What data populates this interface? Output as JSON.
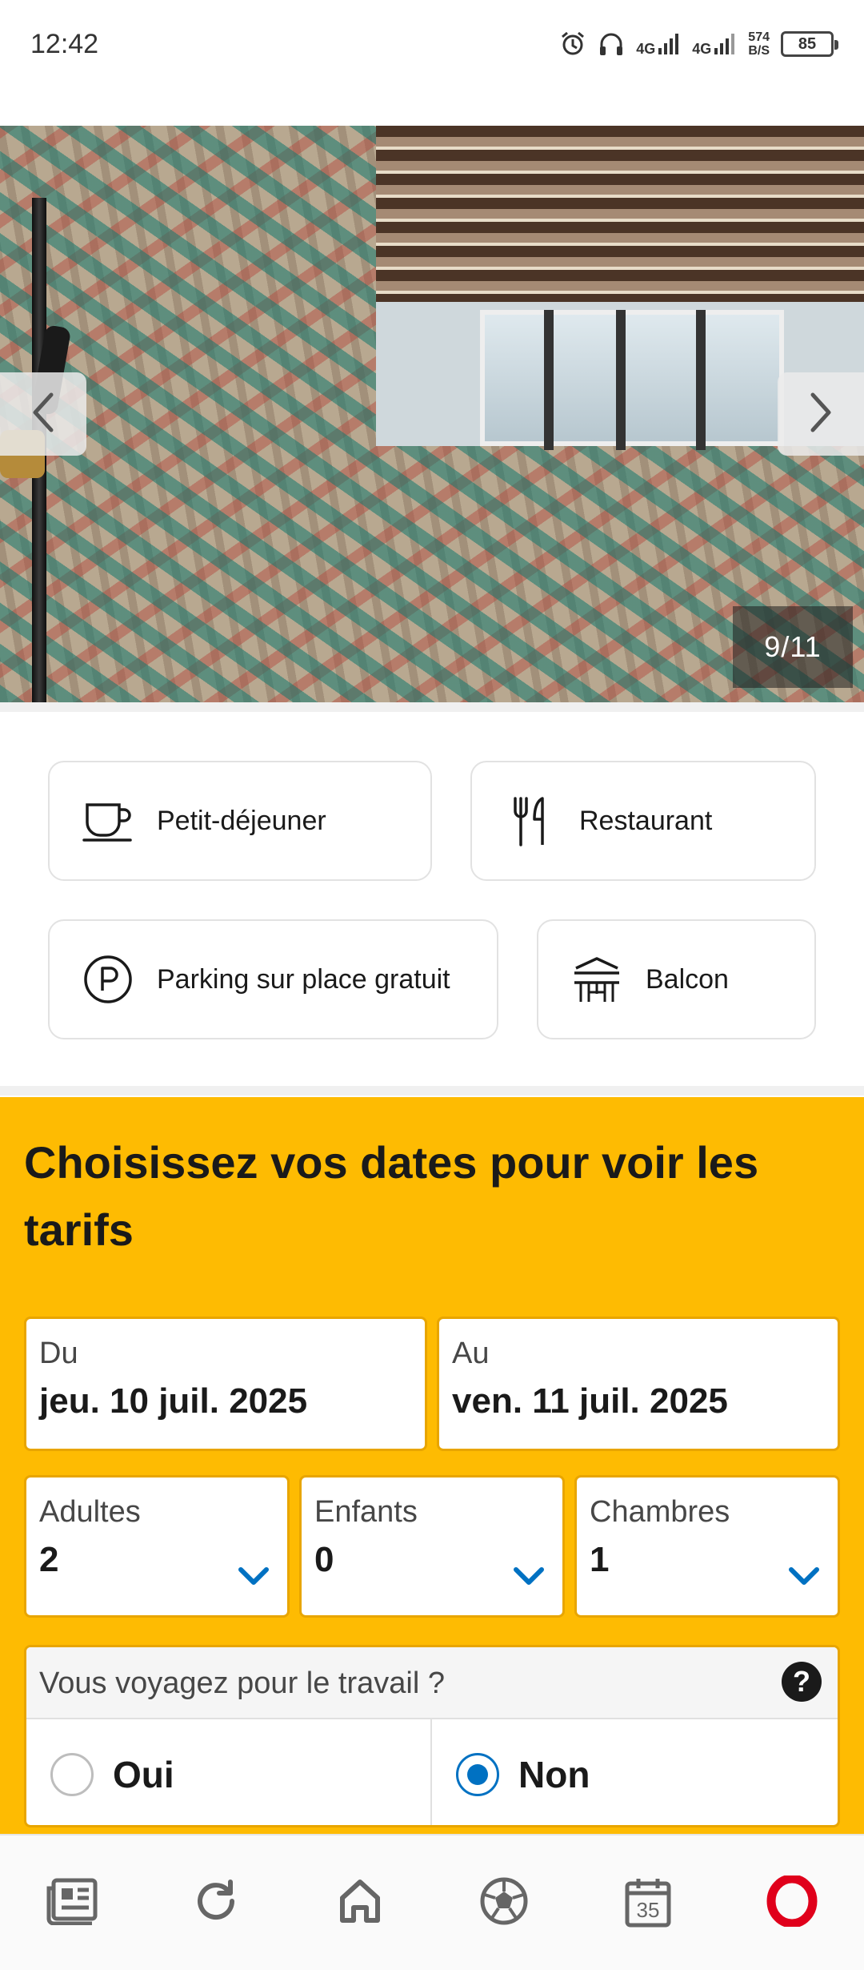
{
  "status_bar": {
    "time": "12:42",
    "network_1": "4G",
    "network_2": "4G",
    "speed_value": "574",
    "speed_unit": "B/S",
    "battery": "85"
  },
  "gallery": {
    "counter": "9/11",
    "prev_icon": "chevron-left-icon",
    "next_icon": "chevron-right-icon"
  },
  "facilities": [
    {
      "label": "Petit-déjeuner",
      "icon": "coffee-cup-icon"
    },
    {
      "label": "Restaurant",
      "icon": "fork-knife-icon"
    },
    {
      "label": "Parking sur place gratuit",
      "icon": "parking-icon"
    },
    {
      "label": "Balcon",
      "icon": "balcony-icon"
    }
  ],
  "booking": {
    "title": "Choisissez vos dates pour voir les tarifs",
    "checkin": {
      "label": "Du",
      "value": "jeu. 10 juil. 2025"
    },
    "checkout": {
      "label": "Au",
      "value": "ven. 11 juil. 2025"
    },
    "adults": {
      "label": "Adultes",
      "value": "2"
    },
    "children": {
      "label": "Enfants",
      "value": "0"
    },
    "rooms": {
      "label": "Chambres",
      "value": "1"
    },
    "work_question": "Vous voyagez pour le travail ?",
    "help": "?",
    "option_yes": "Oui",
    "option_no": "Non",
    "selected_option": "Non"
  },
  "colors": {
    "accent_yellow": "#febb02",
    "border_amber": "#e8a500",
    "link_blue": "#0071c2",
    "opera_red": "#e0001b"
  },
  "bottom_nav": [
    {
      "icon": "news-icon"
    },
    {
      "icon": "reload-icon"
    },
    {
      "icon": "home-icon"
    },
    {
      "icon": "football-icon"
    },
    {
      "icon": "calendar-icon",
      "label": "35"
    },
    {
      "icon": "opera-logo-icon"
    }
  ]
}
